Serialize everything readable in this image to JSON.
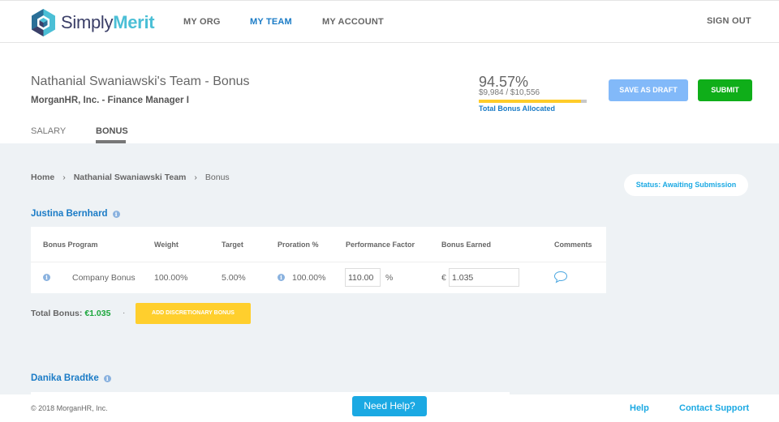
{
  "app": {
    "brand_first": "Simply",
    "brand_second": "Merit"
  },
  "nav": {
    "items": [
      {
        "label": "MY ORG",
        "active": false
      },
      {
        "label": "MY TEAM",
        "active": true
      },
      {
        "label": "MY ACCOUNT",
        "active": false
      }
    ],
    "sign_out": "SIGN OUT"
  },
  "header": {
    "title": "Nathanial Swaniawski's Team - Bonus",
    "subtitle": "MorganHR, Inc. - Finance Manager I",
    "tabs": [
      {
        "label": "SALARY",
        "active": false
      },
      {
        "label": "BONUS",
        "active": true
      }
    ],
    "allocation": {
      "percent_text": "94.57%",
      "amount_text": "$9,984 / $10,556",
      "progress_fraction": 0.9457,
      "label": "Total Bonus Allocated"
    },
    "save_draft_label": "SAVE AS DRAFT",
    "submit_label": "SUBMIT"
  },
  "colors": {
    "accent_blue": "#1a7bc6",
    "light_blue": "#1ba9e3",
    "draft_button": "#82b9f9",
    "submit_button": "#0fae19",
    "progress_fill": "#ffcc29",
    "discretionary_button": "#ffcf2d",
    "total_amount": "#1aa63b"
  },
  "breadcrumb": {
    "items": [
      "Home",
      "Nathanial Swaniawski Team",
      "Bonus"
    ],
    "separator": "›"
  },
  "status": {
    "label": "Status: Awaiting Submission"
  },
  "employees": [
    {
      "name": "Justina Bernhard",
      "table": {
        "headers": [
          "Bonus Program",
          "Weight",
          "Target",
          "Proration %",
          "Performance Factor",
          "Bonus Earned",
          "Comments"
        ],
        "rows": [
          {
            "program": "Company Bonus",
            "weight": "100.00%",
            "target": "5.00%",
            "proration": "100.00%",
            "performance_factor": "110.00",
            "performance_unit": "%",
            "currency": "€",
            "bonus_earned": "1.035"
          }
        ]
      },
      "total_label": "Total Bonus:",
      "total_amount": "€1.035",
      "separator": "·",
      "add_discretionary_label": "ADD DISCRETIONARY BONUS"
    },
    {
      "name": "Danika Bradtke"
    }
  ],
  "footer": {
    "copyright": "© 2018 MorganHR, Inc.",
    "need_help": "Need Help?",
    "help": "Help",
    "contact_support": "Contact Support"
  },
  "icons": {
    "info": "i",
    "comment": "speech-bubble"
  }
}
